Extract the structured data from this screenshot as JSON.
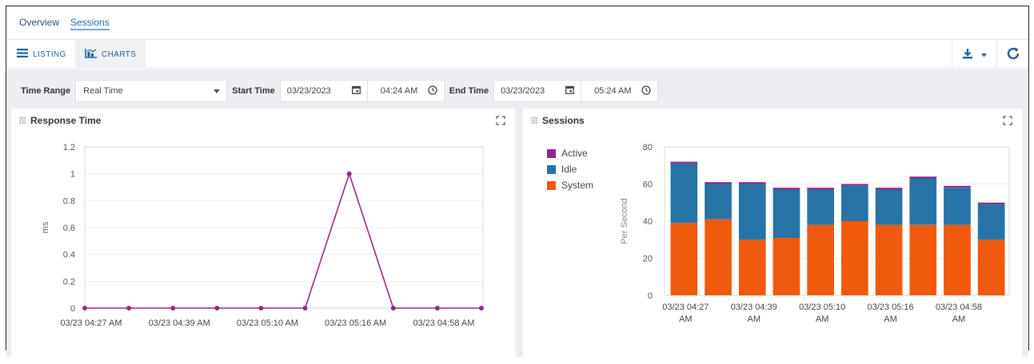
{
  "nav": {
    "tabs": [
      {
        "label": "Overview"
      },
      {
        "label": "Sessions"
      }
    ]
  },
  "view": {
    "listing_label": "LISTING",
    "charts_label": "CHARTS",
    "export_icon": "download-icon",
    "refresh_icon": "refresh-icon"
  },
  "filters": {
    "time_range_label": "Time Range",
    "time_range_value": "Real Time",
    "start_label": "Start Time",
    "start_date": "03/23/2023",
    "start_time": "04:24 AM",
    "end_label": "End Time",
    "end_date": "03/23/2023",
    "end_time": "05:24 AM"
  },
  "colors": {
    "line": "#8b2f84",
    "active": "#8e2a86",
    "idle": "#2773a6",
    "system": "#ef5a0e"
  },
  "response_panel": {
    "title": "Response Time"
  },
  "sessions_panel": {
    "title": "Sessions"
  },
  "chart_data": [
    {
      "type": "line",
      "title": "Response Time",
      "ylabel": "ms",
      "ylim": [
        0,
        1.2
      ],
      "yticks": [
        "0",
        "0.2",
        "0.4",
        "0.6",
        "0.8",
        "1",
        "1.2"
      ],
      "xtick_labels": [
        "03/23 04:27 AM",
        "03/23 04:39 AM",
        "03/23 05:10 AM",
        "03/23 05:16 AM",
        "03/23 04:58 AM"
      ],
      "series": [
        {
          "values": [
            0,
            0,
            0,
            0,
            0,
            0,
            1,
            0,
            0,
            0
          ]
        }
      ]
    },
    {
      "type": "bar",
      "title": "Sessions",
      "ylabel": "Per Second",
      "ylim": [
        0,
        80
      ],
      "yticks": [
        "0",
        "20",
        "40",
        "60",
        "80"
      ],
      "xtick_labels": [
        [
          "03/23 04:27",
          "AM"
        ],
        [
          "03/23 04:39",
          "AM"
        ],
        [
          "03/23 05:10",
          "AM"
        ],
        [
          "03/23 05:16",
          "AM"
        ],
        [
          "03/23 04:58",
          "AM"
        ]
      ],
      "legend_position": "top-left",
      "series": [
        {
          "name": "Active",
          "values": [
            1,
            1,
            1,
            1,
            1,
            1,
            1,
            1,
            1,
            1
          ]
        },
        {
          "name": "Idle",
          "values": [
            32,
            19,
            30,
            26,
            19,
            19,
            19,
            25,
            20,
            19
          ]
        },
        {
          "name": "System",
          "values": [
            39,
            41,
            30,
            31,
            38,
            40,
            38,
            38,
            38,
            30
          ]
        }
      ]
    }
  ]
}
